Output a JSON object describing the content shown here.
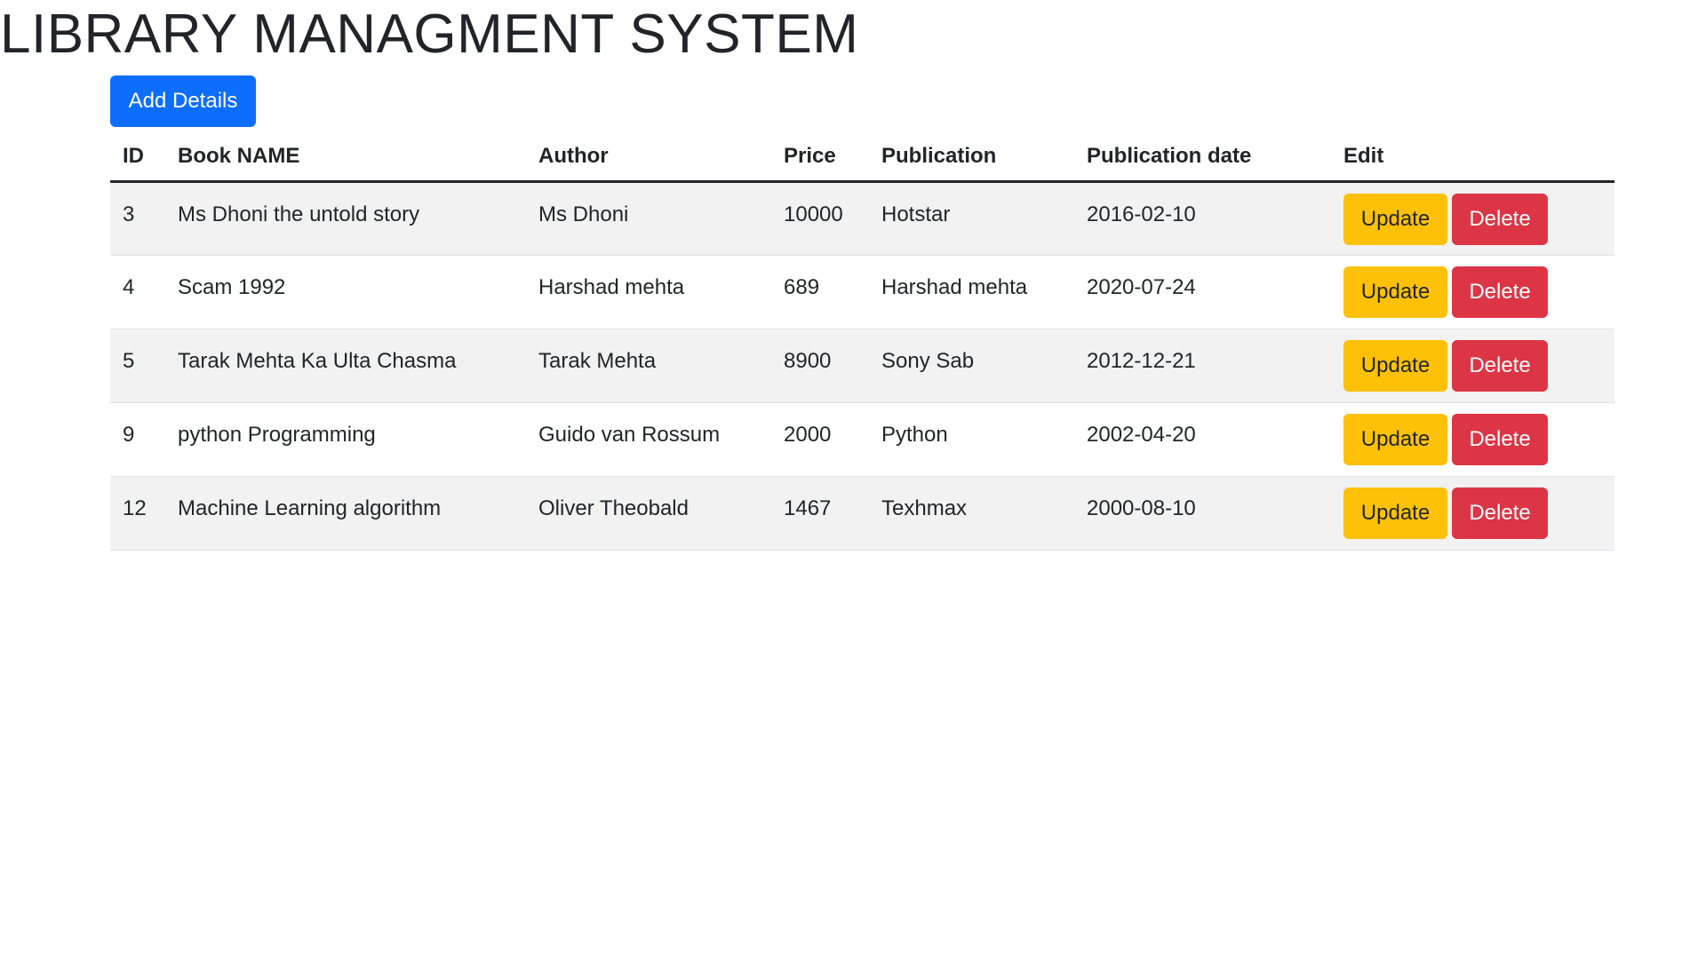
{
  "page": {
    "title": "LIBRARY MANAGMENT SYSTEM",
    "add_button_label": "Add Details"
  },
  "table": {
    "headers": {
      "id": "ID",
      "name": "Book NAME",
      "author": "Author",
      "price": "Price",
      "publication": "Publication",
      "date": "Publication date",
      "edit": "Edit"
    },
    "update_label": "Update",
    "delete_label": "Delete",
    "rows": [
      {
        "id": "3",
        "name": "Ms Dhoni the untold story",
        "author": "Ms Dhoni",
        "price": "10000",
        "publication": "Hotstar",
        "date": "2016-02-10"
      },
      {
        "id": "4",
        "name": "Scam 1992",
        "author": "Harshad mehta",
        "price": "689",
        "publication": "Harshad mehta",
        "date": "2020-07-24"
      },
      {
        "id": "5",
        "name": "Tarak Mehta Ka Ulta Chasma",
        "author": "Tarak Mehta",
        "price": "8900",
        "publication": "Sony Sab",
        "date": "2012-12-21"
      },
      {
        "id": "9",
        "name": "python Programming",
        "author": "Guido van Rossum",
        "price": "2000",
        "publication": "Python",
        "date": "2002-04-20"
      },
      {
        "id": "12",
        "name": "Machine Learning algorithm",
        "author": "Oliver Theobald",
        "price": "1467",
        "publication": "Texhmax",
        "date": "2000-08-10"
      }
    ]
  },
  "colors": {
    "primary": "#0d6efd",
    "warning": "#ffc107",
    "danger": "#dc3545",
    "stripe": "#f2f2f2"
  }
}
